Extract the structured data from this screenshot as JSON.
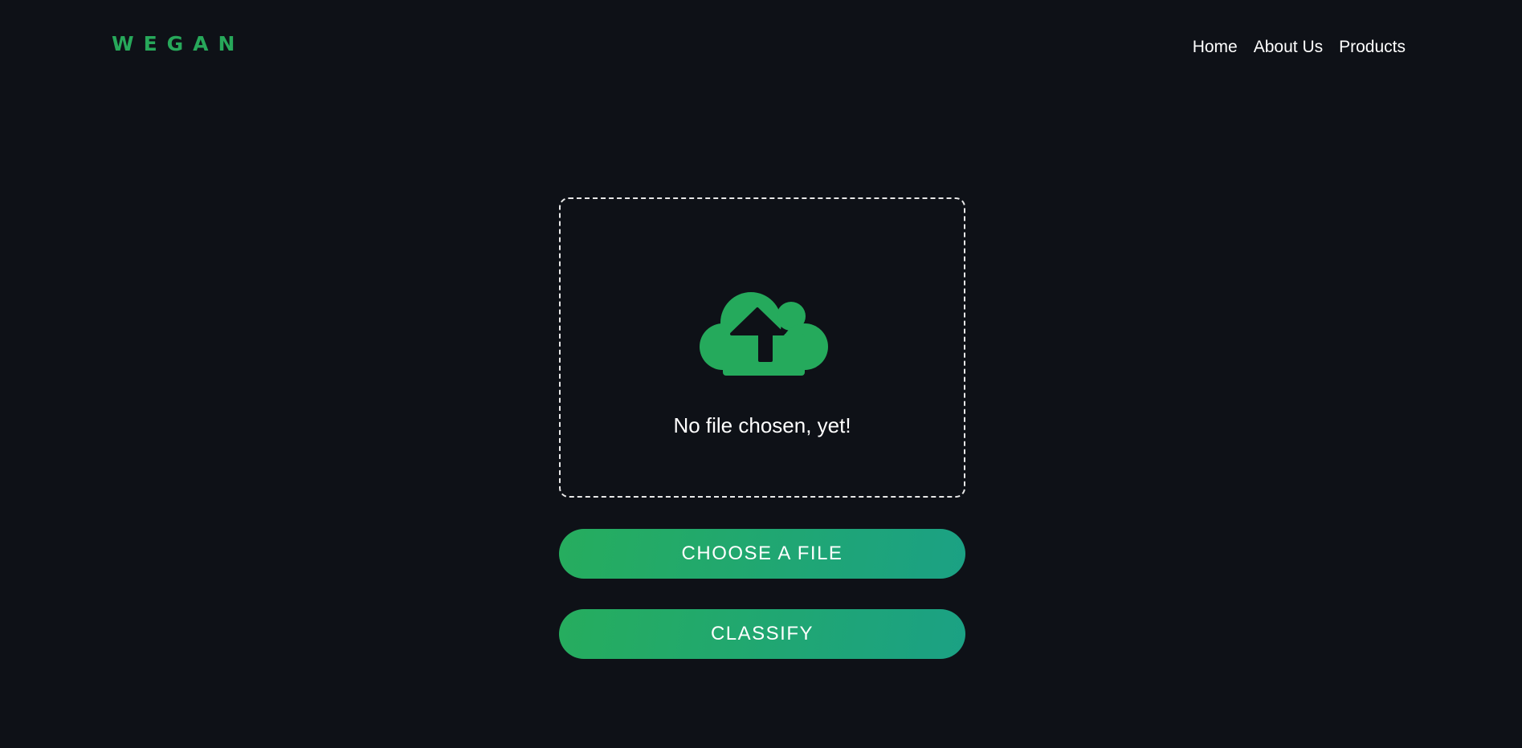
{
  "header": {
    "logo": "WEGAN",
    "nav": [
      "Home",
      "About Us",
      "Products"
    ]
  },
  "upload": {
    "icon": "cloud-upload-icon",
    "status_text": "No file chosen, yet!"
  },
  "buttons": {
    "choose_file": "CHOOSE A FILE",
    "classify": "CLASSIFY"
  },
  "colors": {
    "background": "#0e1117",
    "accent": "#27a85a",
    "button_gradient_start": "#26ad5e",
    "button_gradient_end": "#1ba184",
    "text": "#ffffff"
  }
}
